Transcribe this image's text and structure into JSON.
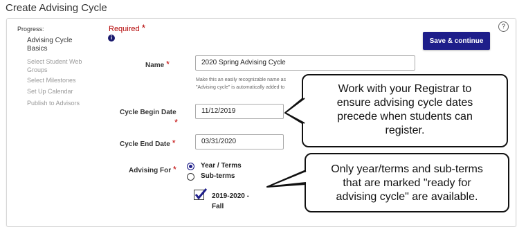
{
  "page": {
    "title": "Create Advising Cycle"
  },
  "sidebar": {
    "progress_label": "Progress:",
    "steps": [
      {
        "label": "Advising Cycle Basics",
        "active": true
      },
      {
        "label": "Select Student Web Groups",
        "active": false
      },
      {
        "label": "Select Milestones",
        "active": false
      },
      {
        "label": "Set Up Calendar",
        "active": false
      },
      {
        "label": "Publish to Advisors",
        "active": false
      }
    ]
  },
  "form": {
    "required_label": "Required",
    "required_star": "*",
    "help_icon": "?",
    "save_button": "Save & continue",
    "name": {
      "label": "Name",
      "value": "2020 Spring Advising Cycle",
      "hint_line1": "Make this an easily recognizable name as",
      "hint_line2": "\"Advising cycle\" is automatically added to"
    },
    "begin_date": {
      "label": "Cycle Begin Date",
      "value": "11/12/2019"
    },
    "end_date": {
      "label": "Cycle End Date",
      "value": "03/31/2020"
    },
    "advising_for": {
      "label": "Advising For",
      "options": [
        {
          "label": "Year / Terms",
          "selected": true
        },
        {
          "label": "Sub-terms",
          "selected": false
        }
      ]
    },
    "term": {
      "line1": "2019-2020 -",
      "line2": "Fall",
      "checked": true
    }
  },
  "callouts": {
    "dates": [
      "Work with your Registrar to",
      "ensure advising cycle dates",
      "precede when students can",
      "register."
    ],
    "terms": [
      "Only year/terms and sub-terms",
      "that are marked \"ready for",
      "advising cycle\" are available."
    ]
  },
  "colors": {
    "primary": "#1e1e8a",
    "required": "#c00000"
  },
  "icons": {
    "info": "info-icon",
    "help": "help-icon",
    "check": "checkmark-icon"
  }
}
